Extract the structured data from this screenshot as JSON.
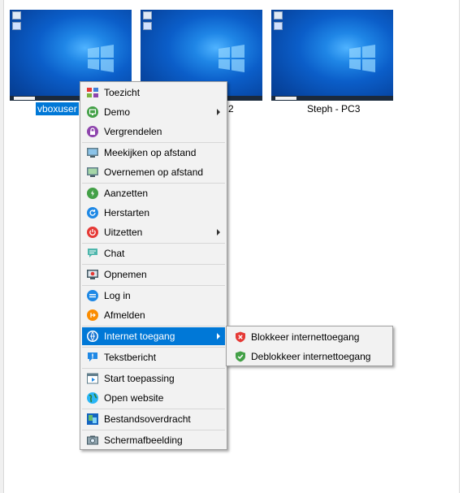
{
  "computers": [
    {
      "caption": "vboxuser",
      "selected": true
    },
    {
      "caption": "2",
      "selected": false
    },
    {
      "caption": "Steph - PC3",
      "selected": false
    }
  ],
  "context_menu": {
    "items": [
      {
        "label": "Toezicht",
        "icon": "grid-view-icon"
      },
      {
        "label": "Demo",
        "icon": "demo-icon",
        "submenu": true
      },
      {
        "label": "Vergrendelen",
        "icon": "lock-icon"
      },
      {
        "label": "Meekijken op afstand",
        "icon": "remote-view-icon"
      },
      {
        "label": "Overnemen op afstand",
        "icon": "remote-control-icon"
      },
      {
        "label": "Aanzetten",
        "icon": "power-on-icon"
      },
      {
        "label": "Herstarten",
        "icon": "restart-icon"
      },
      {
        "label": "Uitzetten",
        "icon": "power-off-icon",
        "submenu": true
      },
      {
        "label": "Chat",
        "icon": "chat-icon"
      },
      {
        "label": "Opnemen",
        "icon": "record-icon"
      },
      {
        "label": "Log in",
        "icon": "login-icon"
      },
      {
        "label": "Afmelden",
        "icon": "logout-icon"
      },
      {
        "label": "Internet toegang",
        "icon": "internet-icon",
        "submenu": true,
        "active": true
      },
      {
        "label": "Tekstbericht",
        "icon": "message-icon"
      },
      {
        "label": "Start toepassing",
        "icon": "start-app-icon"
      },
      {
        "label": "Open website",
        "icon": "globe-icon"
      },
      {
        "label": "Bestandsoverdracht",
        "icon": "file-transfer-icon"
      },
      {
        "label": "Schermafbeelding",
        "icon": "screenshot-icon"
      }
    ]
  },
  "internet_submenu": {
    "items": [
      {
        "label": "Blokkeer internettoegang",
        "icon": "shield-block-icon"
      },
      {
        "label": "Deblokkeer internettoegang",
        "icon": "shield-unblock-icon"
      }
    ]
  },
  "colors": {
    "accent": "#0078d7",
    "menu_bg": "#f2f2f2"
  }
}
